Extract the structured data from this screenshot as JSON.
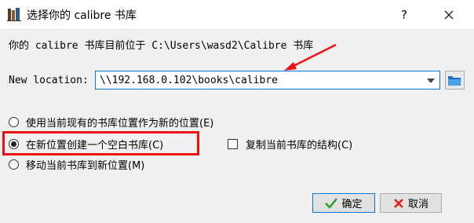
{
  "window": {
    "title": "选择你的 calibre 书库",
    "help_glyph": "?",
    "icon": "calibre-books-icon"
  },
  "heading": "你的 calibre 书库目前位于 C:\\Users\\wasd2\\Calibre 书库",
  "location": {
    "label": "New location:",
    "value": "\\\\192.168.0.102\\books\\calibre"
  },
  "options": [
    {
      "label": "使用当前现有的书库位置作为新的位置(E)",
      "checked": false
    },
    {
      "label": "在新位置创建一个空白书库(C)",
      "checked": true
    },
    {
      "label": "移动当前书库到新位置(M)",
      "checked": false
    }
  ],
  "copy_structure": {
    "label": "复制当前书库的结构(C)",
    "checked": false
  },
  "buttons": {
    "ok": "确定",
    "cancel": "取消"
  },
  "colors": {
    "annotation": "#ee1111",
    "ok_icon": "#2e9e2e",
    "cancel_icon": "#d9241c",
    "accent": "#0078d7"
  }
}
